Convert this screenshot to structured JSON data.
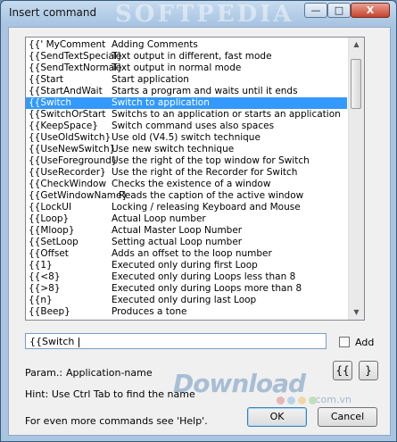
{
  "window": {
    "title": "Insert command",
    "watermark": "SOFTPEDIA",
    "controls": {
      "minimize": "—",
      "maximize": "□",
      "close": "X"
    }
  },
  "commands": [
    {
      "cmd": "{{' MyComment",
      "desc": "Adding Comments"
    },
    {
      "cmd": "{{SendTextSpecial}",
      "desc": "Text output in different, fast mode"
    },
    {
      "cmd": "{{SendTextNormal}",
      "desc": "Text output in normal mode"
    },
    {
      "cmd": "{{Start",
      "desc": "Start application"
    },
    {
      "cmd": "{{StartAndWait",
      "desc": "Starts a program and waits until it ends"
    },
    {
      "cmd": "{{Switch",
      "desc": "Switch to application",
      "selected": true
    },
    {
      "cmd": "{{SwitchOrStart",
      "desc": "Switchs to an application or starts an application"
    },
    {
      "cmd": "{{KeepSpace}",
      "desc": "Switch command uses also spaces"
    },
    {
      "cmd": "{{UseOldSwitch}",
      "desc": "Use old (V4.5) switch technique"
    },
    {
      "cmd": "{{UseNewSwitch}",
      "desc": "Use new switch technique"
    },
    {
      "cmd": "{{UseForeground}",
      "desc": "Use the right of the top window for Switch"
    },
    {
      "cmd": "{{UseRecorder}",
      "desc": "Use the right of the Recorder for Switch"
    },
    {
      "cmd": "{{CheckWindow",
      "desc": "Checks the existence of a window"
    },
    {
      "cmd": "{{GetWindowName}",
      "desc": "Reads the caption of the active window",
      "shift": true
    },
    {
      "cmd": "{{LockUI",
      "desc": "Locking / releasing Keyboard and Mouse"
    },
    {
      "cmd": "{{Loop}",
      "desc": "Actual Loop number"
    },
    {
      "cmd": "{{Mloop}",
      "desc": "Actual Master Loop Number"
    },
    {
      "cmd": "{{SetLoop",
      "desc": "Setting actual Loop number"
    },
    {
      "cmd": "{{Offset",
      "desc": "Adds an offset to the loop number"
    },
    {
      "cmd": "{{1}",
      "desc": "Executed only during first Loop"
    },
    {
      "cmd": "{{<8}",
      "desc": "Executed only during Loops less than 8"
    },
    {
      "cmd": "{{>8}",
      "desc": "Executed only during Loops more than 8"
    },
    {
      "cmd": "{{n}",
      "desc": "Executed only during last Loop"
    },
    {
      "cmd": "{{Beep}",
      "desc": "Produces a tone"
    }
  ],
  "input": {
    "value": "{{Switch "
  },
  "add_label": "Add",
  "param": {
    "label": "Param.:",
    "value": "Application-name"
  },
  "bracket_buttons": {
    "open": "{{",
    "close": "}"
  },
  "hint": "Hint: Use Ctrl Tab to find the name",
  "more_info": "For even more commands see 'Help'.",
  "buttons": {
    "ok": "OK",
    "cancel": "Cancel"
  },
  "logo": {
    "text": "Download",
    "suffix": ".com.vn"
  },
  "colors": {
    "selection": "#3399ff",
    "frame": "#a9c5e2"
  }
}
